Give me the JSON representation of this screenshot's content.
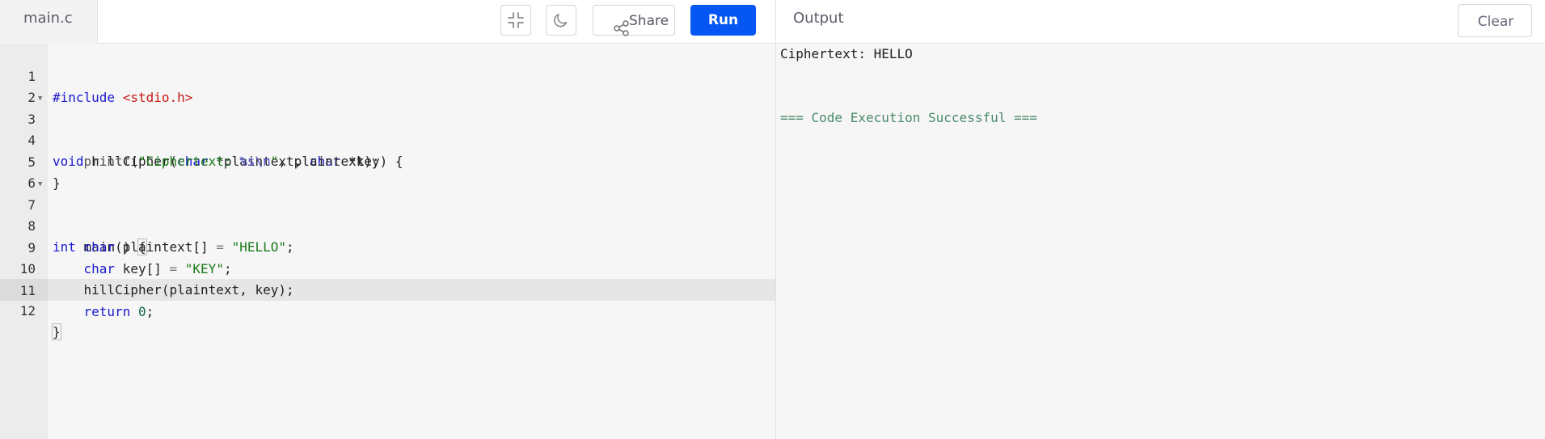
{
  "file_tab": {
    "name": "main.c"
  },
  "toolbar": {
    "collapse_icon": "collapse-icon",
    "theme_icon": "moon-icon",
    "share_label": "Share",
    "share_icon": "share-icon",
    "run_label": "Run"
  },
  "output": {
    "title": "Output",
    "clear_label": "Clear",
    "lines": [
      "Ciphertext: HELLO",
      "=== Code Execution Successful ==="
    ]
  },
  "editor": {
    "active_line": 12,
    "lines": [
      {
        "n": "1",
        "text": "#include <stdio.h>"
      },
      {
        "n": "2",
        "text": ""
      },
      {
        "n": "3",
        "text": "void hillCipher(char *plaintext, char *key) {"
      },
      {
        "n": "4",
        "text": "    printf(\"Ciphertext: %s\\n\", plaintext);"
      },
      {
        "n": "5",
        "text": "}"
      },
      {
        "n": "6",
        "text": ""
      },
      {
        "n": "7",
        "text": "int main() {"
      },
      {
        "n": "8",
        "text": "    char plaintext[] = \"HELLO\";"
      },
      {
        "n": "9",
        "text": "    char key[] = \"KEY\";"
      },
      {
        "n": "10",
        "text": "    hillCipher(plaintext, key);"
      },
      {
        "n": "11",
        "text": "    return 0;"
      },
      {
        "n": "12",
        "text": "}"
      }
    ]
  },
  "colors": {
    "run_button": "#0556f3",
    "keyword": "#1a1acc",
    "string": "#1a7a1a",
    "include": "#c41a16",
    "success": "#4a8a6a"
  }
}
